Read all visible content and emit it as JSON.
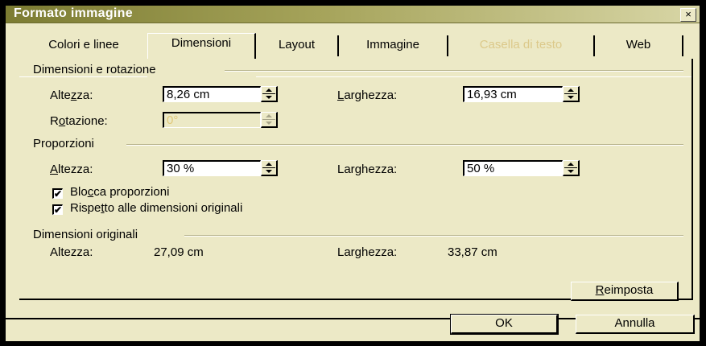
{
  "dialog": {
    "title": "Formato immagine",
    "close": "×"
  },
  "tabs": [
    "Colori e linee",
    "Dimensioni",
    "Layout",
    "Immagine",
    "Casella di testo",
    "Web"
  ],
  "active_tab": "Dimensioni",
  "disabled_tabs": [
    "Casella di testo"
  ],
  "sections": {
    "size_rotation": {
      "title": "Dimensioni e rotazione",
      "height_label_pre": "Alte",
      "height_label_ul": "z",
      "height_label_post": "za:",
      "height_value": "8,26 cm",
      "width_label_pre": "",
      "width_label_ul": "L",
      "width_label_post": "arghezza:",
      "width_value": "16,93 cm",
      "rotation_label_pre": "R",
      "rotation_label_ul": "o",
      "rotation_label_post": "tazione:",
      "rotation_value": "0°"
    },
    "scale": {
      "title": "Proporzioni",
      "height_label_pre": "",
      "height_label_ul": "A",
      "height_label_post": "ltezza:",
      "height_value": "30 %",
      "width_label_pre": "Lar",
      "width_label_ul": "g",
      "width_label_post": "hezza:",
      "width_value": "50 %",
      "lock_pre": "Blo",
      "lock_ul": "c",
      "lock_post": "ca proporzioni",
      "lock_checked": true,
      "relative_pre": "Rispe",
      "relative_ul": "t",
      "relative_post": "to alle dimensioni originali",
      "relative_checked": true,
      "check_mark": "✔"
    },
    "original": {
      "title": "Dimensioni originali",
      "height_label": "Altezza:",
      "height_value": "27,09 cm",
      "width_label": "Larghezza:",
      "width_value": "33,87 cm"
    }
  },
  "buttons": {
    "reset_ul": "R",
    "reset_post": "eimposta",
    "ok": "OK",
    "cancel": "Annulla"
  },
  "colors": {
    "dialog_bg": "#ece9c6",
    "title_gradient_start": "#7c7c32",
    "disabled_text": "#dcc98a"
  }
}
